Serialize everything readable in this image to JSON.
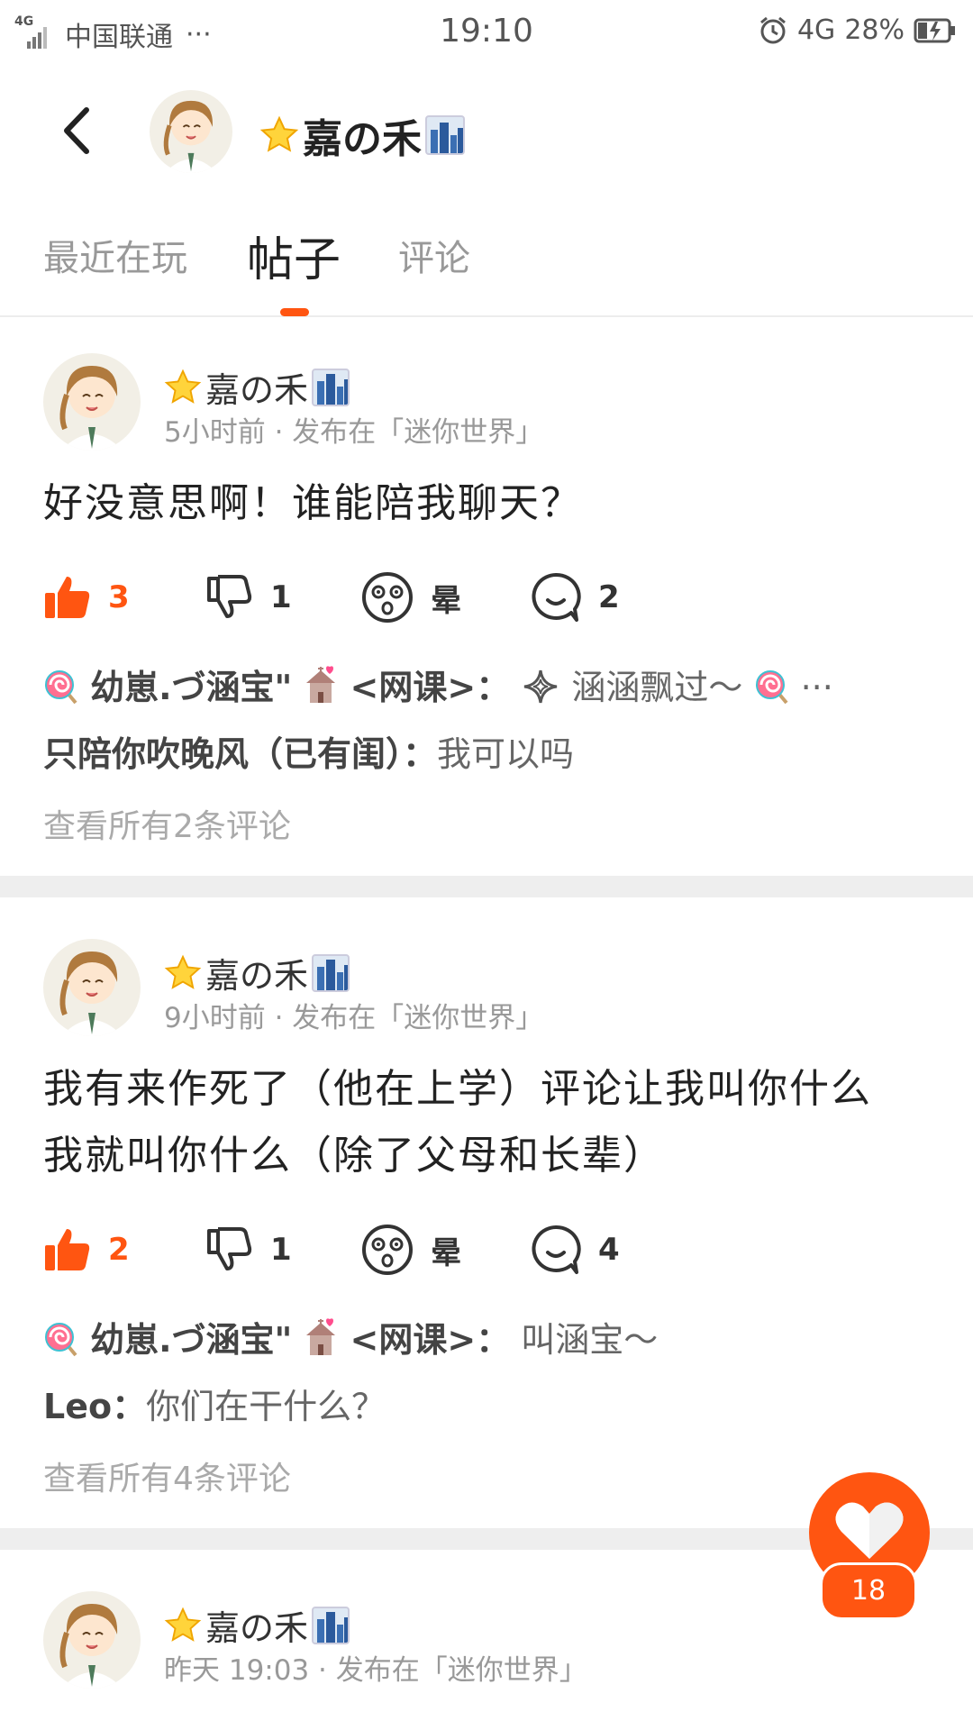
{
  "status_bar": {
    "network_small": "4G",
    "carrier": "中国联通",
    "more": "···",
    "time": "19:10",
    "network": "4G",
    "battery": "28%"
  },
  "header": {
    "title": "嘉の禾",
    "back_icon": "chevron-left-icon"
  },
  "tabs": [
    {
      "label": "最近在玩",
      "active": false
    },
    {
      "label": "帖子",
      "active": true
    },
    {
      "label": "评论",
      "active": false
    }
  ],
  "accent_color": "#ff5511",
  "posts": [
    {
      "author": "嘉の禾",
      "time": "5小时前",
      "published_in": "发布在「迷你世界」",
      "content": [
        "好没意思啊！谁能陪我聊天？"
      ],
      "likes": "3",
      "dislikes": "1",
      "dizzy": "晕",
      "comments": "2",
      "comment_list": [
        {
          "author": "幼崽.づ涵宝\"",
          "author_suffix": "<网课>：",
          "text": "涵涵飘过～",
          "more": "···"
        },
        {
          "author": "只陪你吹晚风（已有闺）：",
          "text": "我可以吗"
        }
      ],
      "view_all": "查看所有2条评论"
    },
    {
      "author": "嘉の禾",
      "time": "9小时前",
      "published_in": "发布在「迷你世界」",
      "content": [
        "我有来作死了（他在上学）评论让我叫你什么",
        "我就叫你什么（除了父母和长辈）"
      ],
      "likes": "2",
      "dislikes": "1",
      "dizzy": "晕",
      "comments": "4",
      "comment_list": [
        {
          "author": "幼崽.づ涵宝\"",
          "author_suffix": "<网课>：",
          "text": "叫涵宝～"
        },
        {
          "author": "Leo：",
          "text": "你们在干什么？"
        }
      ],
      "view_all": "查看所有4条评论"
    },
    {
      "author": "嘉の禾",
      "time": "昨天 19:03",
      "published_in": "发布在「迷你世界」"
    }
  ],
  "fab": {
    "count": "18"
  }
}
